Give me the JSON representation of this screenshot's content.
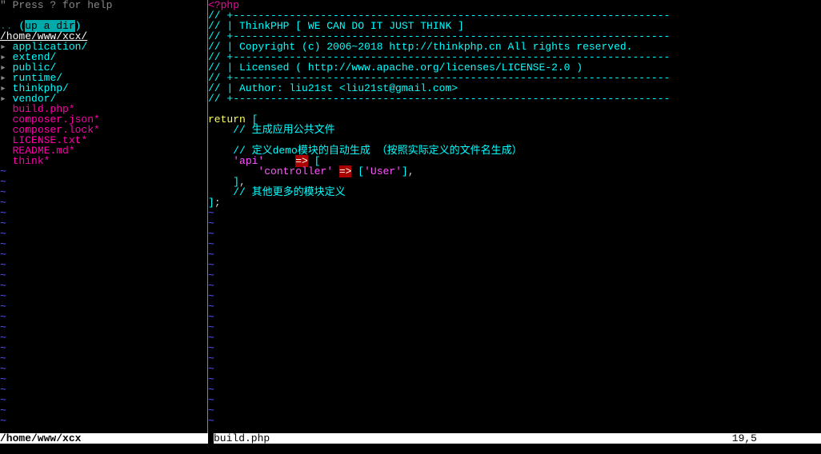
{
  "help_text": "\" Press ? for help",
  "updir_prefix": ".. ",
  "updir_text": "up a dir",
  "current_path": "/home/www/xcx/",
  "tree_entries": [
    {
      "bullet": "▸ ",
      "name": "application/",
      "type": "dir"
    },
    {
      "bullet": "▸ ",
      "name": "extend/",
      "type": "dir"
    },
    {
      "bullet": "▸ ",
      "name": "public/",
      "type": "dir"
    },
    {
      "bullet": "▸ ",
      "name": "runtime/",
      "type": "dir"
    },
    {
      "bullet": "▸ ",
      "name": "thinkphp/",
      "type": "dir"
    },
    {
      "bullet": "▸ ",
      "name": "vendor/",
      "type": "dir"
    },
    {
      "bullet": "  ",
      "name": "build.php*",
      "type": "file"
    },
    {
      "bullet": "  ",
      "name": "composer.json*",
      "type": "file"
    },
    {
      "bullet": "  ",
      "name": "composer.lock*",
      "type": "file"
    },
    {
      "bullet": "  ",
      "name": "LICENSE.txt*",
      "type": "file"
    },
    {
      "bullet": "  ",
      "name": "README.md*",
      "type": "file"
    },
    {
      "bullet": "  ",
      "name": "think*",
      "type": "file"
    }
  ],
  "code_lines": [
    [
      {
        "cls": "php-tag",
        "t": "<?php"
      }
    ],
    [
      {
        "cls": "comment",
        "t": "// +----------------------------------------------------------------------"
      }
    ],
    [
      {
        "cls": "comment",
        "t": "// | ThinkPHP [ WE CAN DO IT JUST THINK ]"
      }
    ],
    [
      {
        "cls": "comment",
        "t": "// +----------------------------------------------------------------------"
      }
    ],
    [
      {
        "cls": "comment",
        "t": "// | Copyright (c) 2006~2018 http://thinkphp.cn All rights reserved."
      }
    ],
    [
      {
        "cls": "comment",
        "t": "// +----------------------------------------------------------------------"
      }
    ],
    [
      {
        "cls": "comment",
        "t": "// | Licensed ( http://www.apache.org/licenses/LICENSE-2.0 )"
      }
    ],
    [
      {
        "cls": "comment",
        "t": "// +----------------------------------------------------------------------"
      }
    ],
    [
      {
        "cls": "comment",
        "t": "// | Author: liu21st <liu21st@gmail.com>"
      }
    ],
    [
      {
        "cls": "comment",
        "t": "// +----------------------------------------------------------------------"
      }
    ],
    [],
    [
      {
        "cls": "keyword",
        "t": "return"
      },
      {
        "cls": "default",
        "t": " "
      },
      {
        "cls": "bracket",
        "t": "["
      }
    ],
    [
      {
        "cls": "default",
        "t": "    "
      },
      {
        "cls": "comment",
        "t": "// 生成应用公共文件"
      }
    ],
    [],
    [
      {
        "cls": "default",
        "t": "    "
      },
      {
        "cls": "comment",
        "t": "// 定义demo模块的自动生成 （按照实际定义的文件名生成）"
      }
    ],
    [
      {
        "cls": "default",
        "t": "    "
      },
      {
        "cls": "string",
        "t": "'api'"
      },
      {
        "cls": "default",
        "t": "     "
      },
      {
        "cls": "arrow-hl",
        "t": "=>"
      },
      {
        "cls": "default",
        "t": " "
      },
      {
        "cls": "bracket",
        "t": "["
      }
    ],
    [
      {
        "cls": "default",
        "t": "        "
      },
      {
        "cls": "string",
        "t": "'controller'"
      },
      {
        "cls": "default",
        "t": " "
      },
      {
        "cls": "arrow-hl",
        "t": "=>"
      },
      {
        "cls": "default",
        "t": " "
      },
      {
        "cls": "bracket",
        "t": "["
      },
      {
        "cls": "string",
        "t": "'User'"
      },
      {
        "cls": "bracket",
        "t": "]"
      },
      {
        "cls": "default",
        "t": ","
      }
    ],
    [
      {
        "cls": "default",
        "t": "    "
      },
      {
        "cls": "bracket",
        "t": "]"
      },
      {
        "cls": "default",
        "t": ","
      }
    ],
    [
      {
        "cls": "default",
        "t": "    "
      },
      {
        "cls": "comment",
        "t": "// 其他更多的模块定义"
      }
    ],
    [
      {
        "cls": "bracket",
        "t": "]"
      },
      {
        "cls": "default",
        "t": ";"
      }
    ]
  ],
  "status_left": "/home/www/xcx",
  "status_right_file": "build.php",
  "status_right_pos": "19,5"
}
